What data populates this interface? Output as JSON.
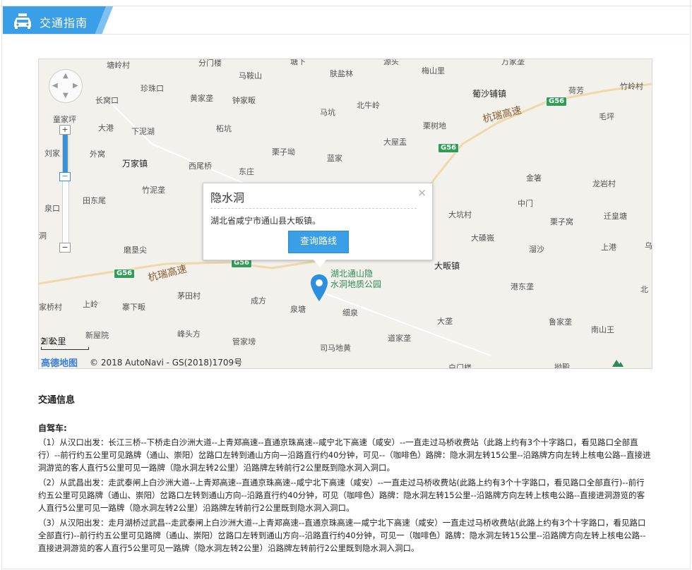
{
  "header": {
    "tab_label": "交通指南",
    "tab_icon": "car-icon",
    "accent": "#3b9fe8"
  },
  "map": {
    "places": [
      "塘岭村",
      "分门楼",
      "马鞍山",
      "塘下",
      "肤盐林",
      "源头",
      "梅山里",
      "万家垄",
      "珍珠口",
      "长窝口",
      "黄家垄",
      "钟家畈",
      "北牛岭",
      "葡沙铺镇",
      "荷芳",
      "竹岭村",
      "童家坪",
      "马坑",
      "栗树地",
      "毛坪",
      "大港",
      "下泥湖",
      "柘坑",
      "大屋盂",
      "刘家",
      "外窝",
      "万家镇",
      "西尾桥",
      "栗子坳",
      "蓝家",
      "东庄",
      "金箸",
      "龙岩村",
      "竹泥垄",
      "田东尾",
      "中门",
      "泉口",
      "大坑村",
      "栗子窝",
      "迁皇塘",
      "洞",
      "大磉嶶",
      "溜沙",
      "上港",
      "磨垦尖",
      "大畈镇",
      "茅田村",
      "港东垄",
      "北",
      "家桥村",
      "上岭",
      "寨下畈",
      "成方",
      "泉塘",
      "细泉",
      "大垄",
      "鲁家垄",
      "南山王",
      "新屋院",
      "峰头方",
      "刘家",
      "管家塝",
      "司马地黄",
      "道家垄",
      "白门楼",
      "拗殿",
      "乌"
    ],
    "highways": [
      "杭瑞高速",
      "杭瑞高速"
    ],
    "shields": [
      "G56",
      "G56",
      "G56",
      "G56"
    ],
    "poi_label_lines": [
      "湖北通山隐",
      "水洞地质公园"
    ],
    "popup": {
      "title": "隐水洞",
      "close": "×",
      "address": "湖北省咸宁市通山县大畈镇。",
      "route_button": "查询路线"
    },
    "zoom_in": "+",
    "zoom_out": "−",
    "zoom_handle": "−",
    "scale_label": "2 公里",
    "logo": "高德地图",
    "copyright": "© 2018 AutoNavi - GS(2018)1709号"
  },
  "traffic": {
    "heading": "交通信息",
    "self_drive_title": "自驾车:",
    "routes": [
      "（1）从汉口出发：长江三桥--下桥走白沙洲大道--上青郑高速--直通京珠高速--咸宁北下高速（咸安）--一直走过马桥收费站（此路上约有3个十字路口，看见路口全部直行）--前行约五公里可见路牌（通山、崇阳）岔路口左转到通山方向—沿路直行约40分钟，可见--（咖啡色）路牌：隐水洞左转15公里--沿路牌方向左转上核电公路--直接进洞游览的客人直行5公里可见一路牌（隐水洞左转2公里）沿路牌左转前行2公里既到隐水洞入洞口。",
      "（2）从武昌出发：走武泰闸上白沙洲大道--上青郑高速--直通京珠高速--咸宁北下高速（咸安）--一直走过马桥收费站(此路上约有3个十字路口，看见路口全部直行)--前行约五公里可见路牌（通山、崇阳）岔路口左转到通山方向--沿路直行约40分钟，可见（咖啡色）路牌：隐水洞左转15公里--沿路牌方向左转上核电公路--直接进洞游览的客人直行5公里可见一路牌（隐水洞左转2公里）沿路牌左转前行2公里既到隐水洞入洞口。",
      "（3）从汉阳出发：走月湖桥过武昌--走武泰闸上白沙洲大道--上青郑高速--直通京珠高速—咸宁北下高速（咸安）一直走过马桥收费站(此路上约有3个十字路口，看见路口全部直行)--前行约五公里可见路牌（通山、崇阳）岔路口左转到通山方向--沿路直行约40分钟，可见一（咖啡色）路牌：隐水洞左转15公里--沿路牌方向左转上核电公路--直接进洞游览的客人直行5公里可见一路牌（隐水洞左转2公里）沿路牌左转前行2公里既到隐水洞入洞口。"
    ]
  }
}
